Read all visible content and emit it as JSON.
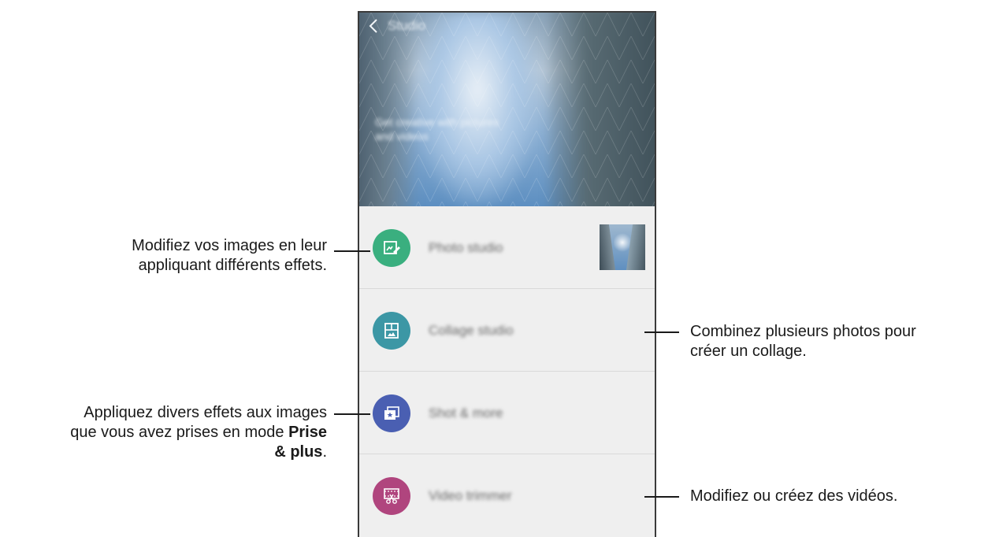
{
  "screen": {
    "header": {
      "back_icon": "chevron-left-icon",
      "title": "Studio"
    },
    "hero": {
      "tagline": "Get creative with pictures and videos"
    },
    "items": [
      {
        "label": "Photo studio",
        "icon": "photo-edit-icon",
        "color": "#3aaf7f"
      },
      {
        "label": "Collage studio",
        "icon": "collage-icon",
        "color": "#3c97a5"
      },
      {
        "label": "Shot & more",
        "icon": "shot-more-icon",
        "color": "#4a5fb2"
      },
      {
        "label": "Video trimmer",
        "icon": "video-trim-icon",
        "color": "#b0457e"
      }
    ]
  },
  "annotations": {
    "photo_studio": {
      "line1": "Modifiez vos images en leur",
      "line2": "appliquant différents effets."
    },
    "collage_studio": {
      "line1": "Combinez plusieurs photos pour",
      "line2": "créer un collage."
    },
    "shot_more": {
      "line1": "Appliquez divers effets aux images",
      "line2_prefix": "que vous avez prises en mode ",
      "line2_bold": "Prise",
      "line3_bold": "& plus",
      "line3_suffix": "."
    },
    "video_trimmer": {
      "line1": "Modifiez ou créez des vidéos."
    }
  }
}
